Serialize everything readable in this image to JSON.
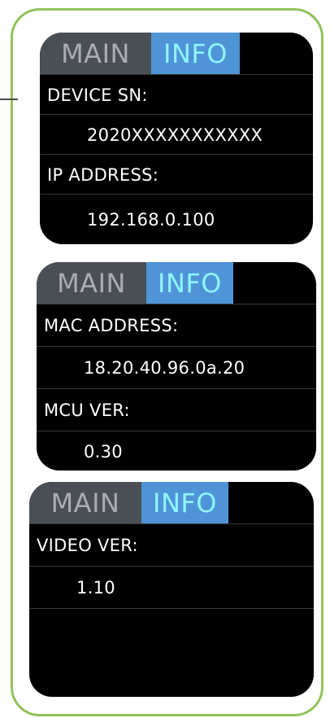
{
  "screens": [
    {
      "tabs": {
        "main": "MAIN",
        "info": "INFO"
      },
      "rows": [
        {
          "kind": "label",
          "text": "DEVICE SN:"
        },
        {
          "kind": "value",
          "text": "2020XXXXXXXXXXX"
        },
        {
          "kind": "label",
          "text": "IP ADDRESS:"
        },
        {
          "kind": "value",
          "text": "192.168.0.100"
        }
      ]
    },
    {
      "tabs": {
        "main": "MAIN",
        "info": "INFO"
      },
      "rows": [
        {
          "kind": "label",
          "text": "MAC ADDRESS:"
        },
        {
          "kind": "value",
          "text": "18.20.40.96.0a.20"
        },
        {
          "kind": "label",
          "text": "MCU VER:"
        },
        {
          "kind": "value",
          "text": "0.30"
        }
      ]
    },
    {
      "tabs": {
        "main": "MAIN",
        "info": "INFO"
      },
      "rows": [
        {
          "kind": "label",
          "text": "VIDEO VER:"
        },
        {
          "kind": "value",
          "text": "1.10"
        },
        {
          "kind": "empty",
          "text": ""
        },
        {
          "kind": "empty",
          "text": ""
        }
      ]
    }
  ]
}
